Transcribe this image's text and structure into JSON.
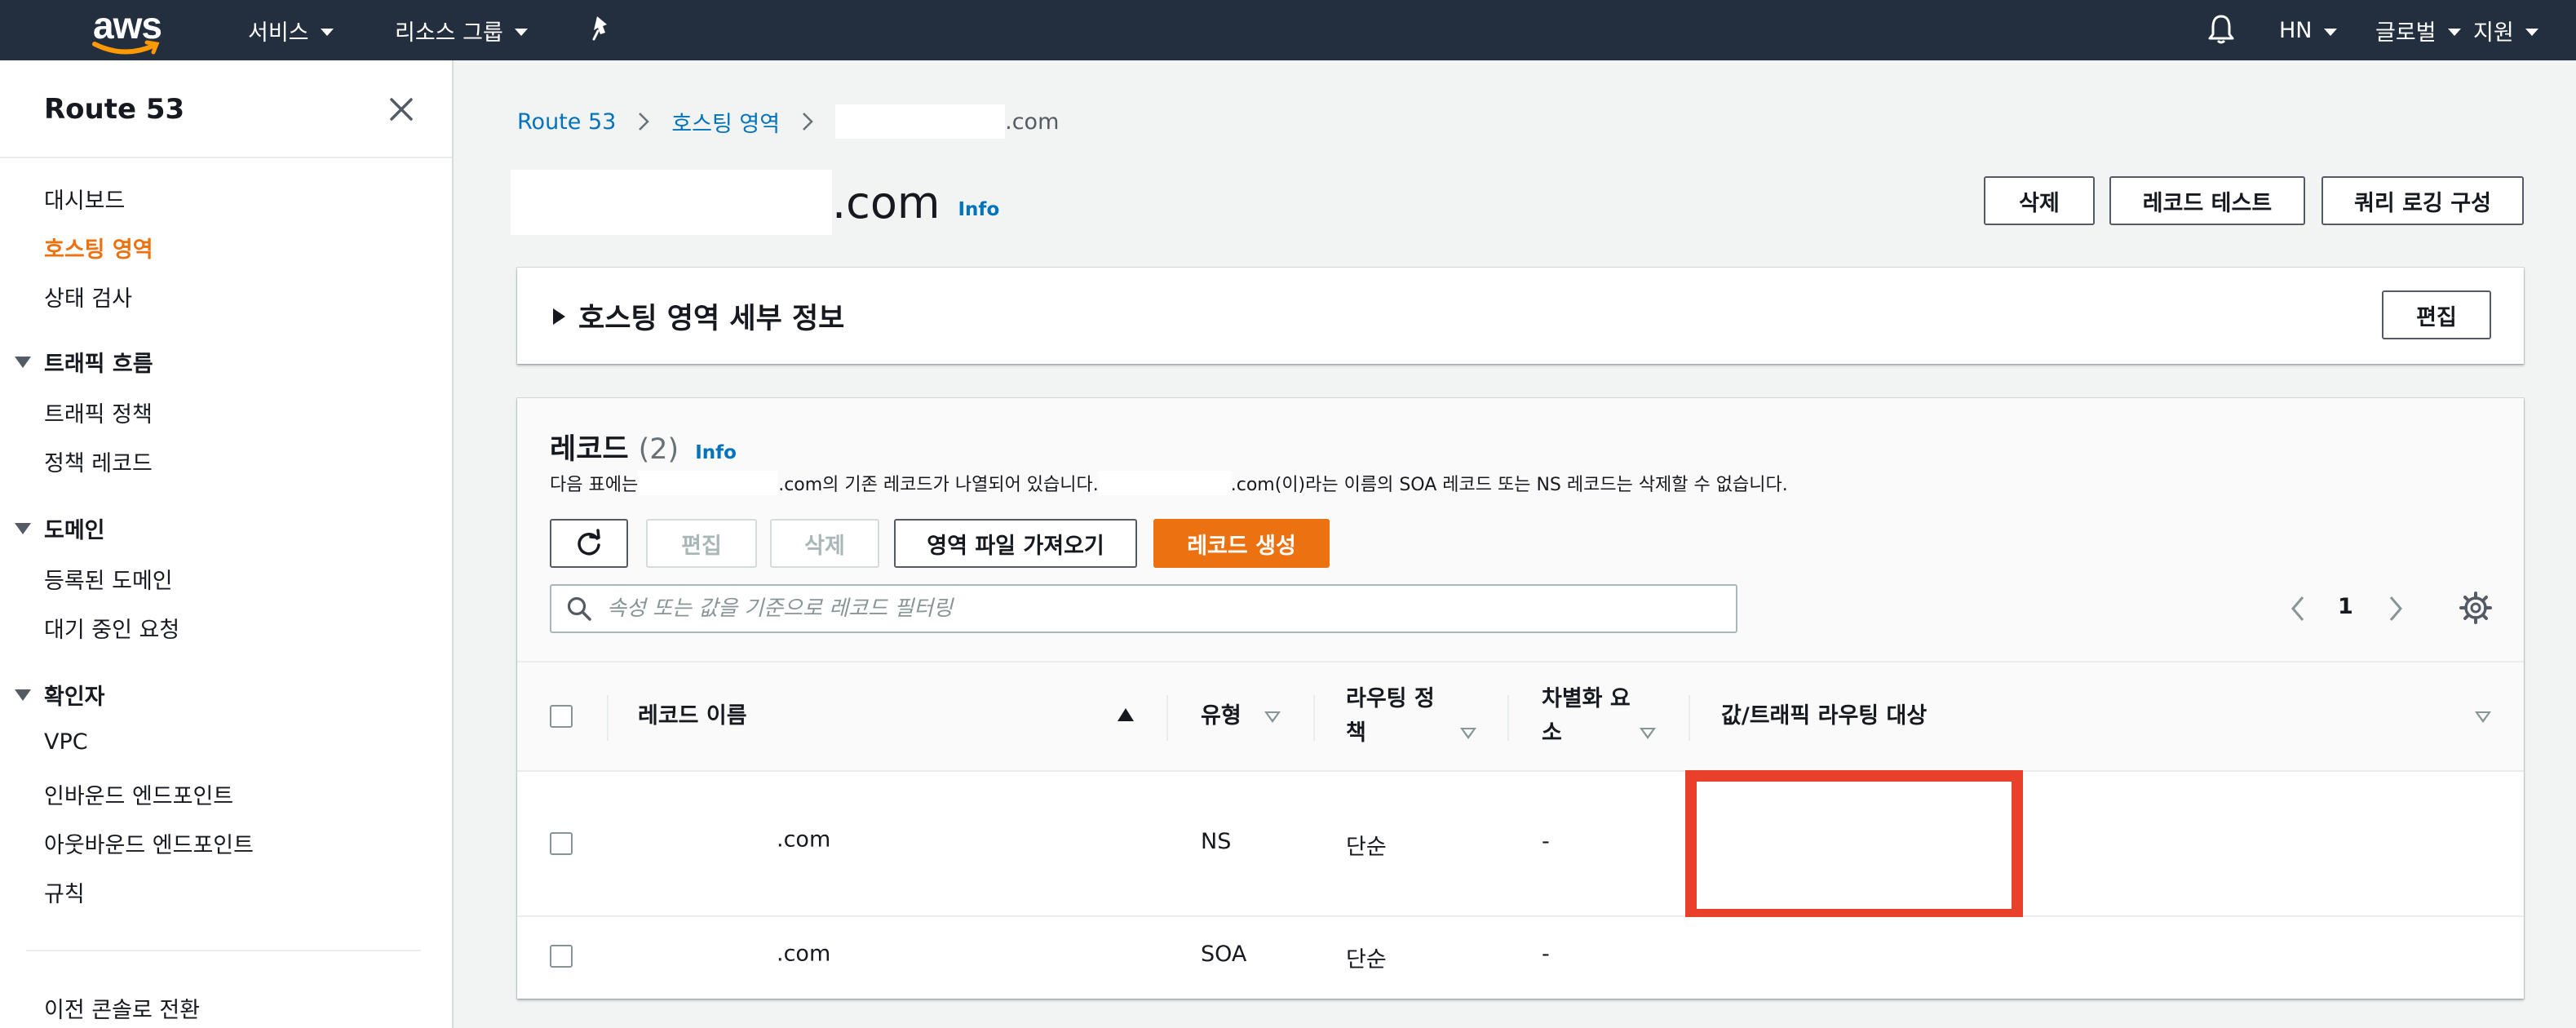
{
  "topnav": {
    "logo_text": "aws",
    "services_label": "서비스",
    "resource_groups_label": "리소스 그룹",
    "account_label": "HN",
    "region_label": "글로벌",
    "support_label": "지원",
    "icons": [
      "pin-icon",
      "bell-icon"
    ],
    "colors": {
      "background": "#232f3e",
      "logo_smile": "#ff9900"
    }
  },
  "sidebar": {
    "title": "Route 53",
    "items": {
      "dashboard": "대시보드",
      "hosted_zones": "호스팅 영역",
      "health_checks": "상태 검사",
      "traffic_flow": "트래픽 흐름",
      "traffic_policies": "트래픽 정책",
      "policy_records": "정책 레코드",
      "domains": "도메인",
      "registered_domains": "등록된 도메인",
      "pending_requests": "대기 중인 요청",
      "resolver": "확인자",
      "vpc": "VPC",
      "inbound_endpoints": "인바운드 엔드포인트",
      "outbound_endpoints": "아웃바운드 엔드포인트",
      "rules": "규칙",
      "switch_console": "이전 콘솔로 전환"
    },
    "active_item": "hosted_zones",
    "active_color": "#ec7211"
  },
  "breadcrumb": {
    "root": "Route 53",
    "hosted_zones": "호스팅 영역",
    "current_suffix": ".com"
  },
  "header": {
    "domain_suffix": ".com",
    "info": "Info",
    "buttons": {
      "delete": "삭제",
      "test_record": "레코드 테스트",
      "query_logging": "쿼리 로깅 구성"
    }
  },
  "details": {
    "title": "호스팅 영역 세부 정보",
    "edit": "편집"
  },
  "records": {
    "title": "레코드",
    "count": "(2)",
    "info": "Info",
    "desc_prefix": "다음 표에는",
    "desc_middle": ".com의 기존 레코드가 나열되어 있습니다.",
    "desc_suffix": ".com(이)라는 이름의 SOA 레코드 또는 NS 레코드는 삭제할 수 없습니다.",
    "actions": {
      "edit": "편집",
      "delete": "삭제",
      "import_zone": "영역 파일 가져오기",
      "create_record": "레코드 생성"
    },
    "search_placeholder": "속성 또는 값을 기준으로 레코드 필터링",
    "page": "1",
    "columns": {
      "name": "레코드 이름",
      "type": "유형",
      "routing": "라우팅 정책",
      "routing_line1": "라우팅 정",
      "routing_line2": "책",
      "diff": "차별화 요소",
      "diff_line1": "차별화 요",
      "diff_line2": "소",
      "value": "값/트래픽 라우팅 대상"
    },
    "rows": [
      {
        "name_suffix": ".com",
        "type": "NS",
        "routing": "단순",
        "diff": "-"
      },
      {
        "name_suffix": ".com",
        "type": "SOA",
        "routing": "단순",
        "diff": "-"
      }
    ],
    "redaction_color": "#e8402a"
  }
}
